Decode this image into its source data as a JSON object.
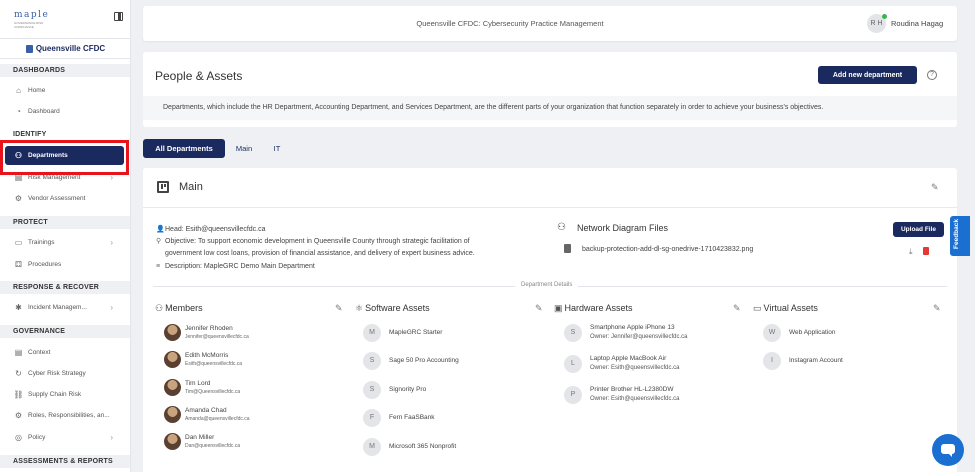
{
  "brand": {
    "logo": "maple",
    "logo_sub": "GOVERNANCE RISK COMPLIANCE"
  },
  "sidebar": {
    "org_name": "Queensville CFDC",
    "sections": {
      "dashboards": "DASHBOARDS",
      "identify": "IDENTIFY",
      "protect": "PROTECT",
      "response": "RESPONSE & RECOVER",
      "governance": "GOVERNANCE",
      "assessments": "ASSESSMENTS & REPORTS"
    },
    "items": {
      "home": "Home",
      "dashboard": "Dashboard",
      "departments": "Departments",
      "risk": "Risk Management",
      "vendor": "Vendor Assessment",
      "trainings": "Trainings",
      "procedures": "Procedures",
      "incident": "Incident Managem...",
      "context": "Context",
      "cyber_strategy": "Cyber Risk Strategy",
      "supply_chain": "Supply Chain Risk",
      "roles": "Roles, Responsibilities, an...",
      "policy": "Policy"
    }
  },
  "topbar": {
    "title": "Queensville CFDC: Cybersecurity Practice Management",
    "avatar_initials": "R H",
    "user_name": "Roudina Hagag"
  },
  "page": {
    "title": "People & Assets",
    "add_button": "Add new department",
    "description": "Departments, which include the HR Department, Accounting Department, and Services Department, are the different parts of your organization that function separately in order to achieve your business's objectives."
  },
  "tabs": {
    "all": "All Departments",
    "main": "Main",
    "it": "IT"
  },
  "department": {
    "name": "Main",
    "head": "Head: Esith@queensvillecfdc.ca",
    "objective_1": "Objective: To support economic development in Queensville County through strategic facilitation of",
    "objective_2": "government low cost loans, provision of financial assistance, and delivery of expert business advice.",
    "description": "Description: MapleGRC Demo Main Department",
    "network_title": "Network Diagram Files",
    "upload_button": "Upload File",
    "file_name": "backup-protection-add-dl-sg-onedrive-1710423832.png",
    "details_label": "Department Details"
  },
  "columns": {
    "members": "Members",
    "software": "Software Assets",
    "hardware": "Hardware Assets",
    "virtual": "Virtual Assets"
  },
  "members": [
    {
      "name": "Jennifer Rhoden",
      "email": "Jennifer@queensvillecfdc.ca"
    },
    {
      "name": "Edith McMorris",
      "email": "Esith@queensvillecfdc.ca"
    },
    {
      "name": "Tim Lord",
      "email": "Tim@Queensvillecfdc.ca"
    },
    {
      "name": "Amanda Chad",
      "email": "Amanda@queensvillecfdc.ca"
    },
    {
      "name": "Dan Miller",
      "email": "Dan@queensvillecfdc.ca"
    }
  ],
  "software": [
    {
      "initial": "M",
      "name": "MapleGRC Starter"
    },
    {
      "initial": "S",
      "name": "Sage 50 Pro Accounting"
    },
    {
      "initial": "S",
      "name": "Signority Pro"
    },
    {
      "initial": "F",
      "name": "Fern FaaSBank"
    },
    {
      "initial": "M",
      "name": "Microsoft 365 Nonprofit"
    }
  ],
  "hardware": [
    {
      "initial": "S",
      "name": "Smartphone Apple iPhone 13",
      "owner": "Owner: Jennifer@queensvillecfdc.ca"
    },
    {
      "initial": "L",
      "name": "Laptop Apple MacBook Air",
      "owner": "Owner: Esith@queensvillecfdc.ca"
    },
    {
      "initial": "P",
      "name": "Printer Brother HL-L2380DW",
      "owner": "Owner: Esith@queensvillecfdc.ca"
    }
  ],
  "virtual": [
    {
      "initial": "W",
      "name": "Web Application"
    },
    {
      "initial": "I",
      "name": "Instagram Account"
    }
  ],
  "feedback": "Feedback"
}
